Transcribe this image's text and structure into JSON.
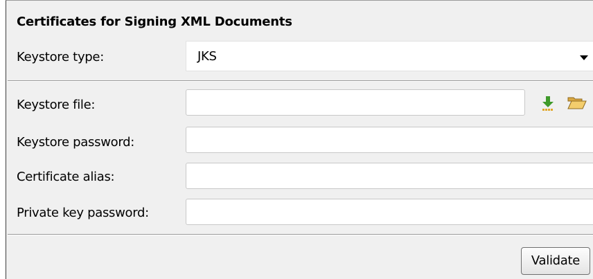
{
  "section": {
    "title": "Certificates for Signing XML Documents"
  },
  "keystore_type": {
    "label": "Keystore type:",
    "value": "JKS"
  },
  "keystore_file": {
    "label": "Keystore file:",
    "value": "",
    "icons": [
      "download-arrow-icon",
      "open-folder-icon"
    ]
  },
  "keystore_password": {
    "label": "Keystore password:",
    "value": ""
  },
  "certificate_alias": {
    "label": "Certificate alias:",
    "value": ""
  },
  "private_key_password": {
    "label": "Private key password:",
    "value": ""
  },
  "buttons": {
    "validate": "Validate"
  }
}
